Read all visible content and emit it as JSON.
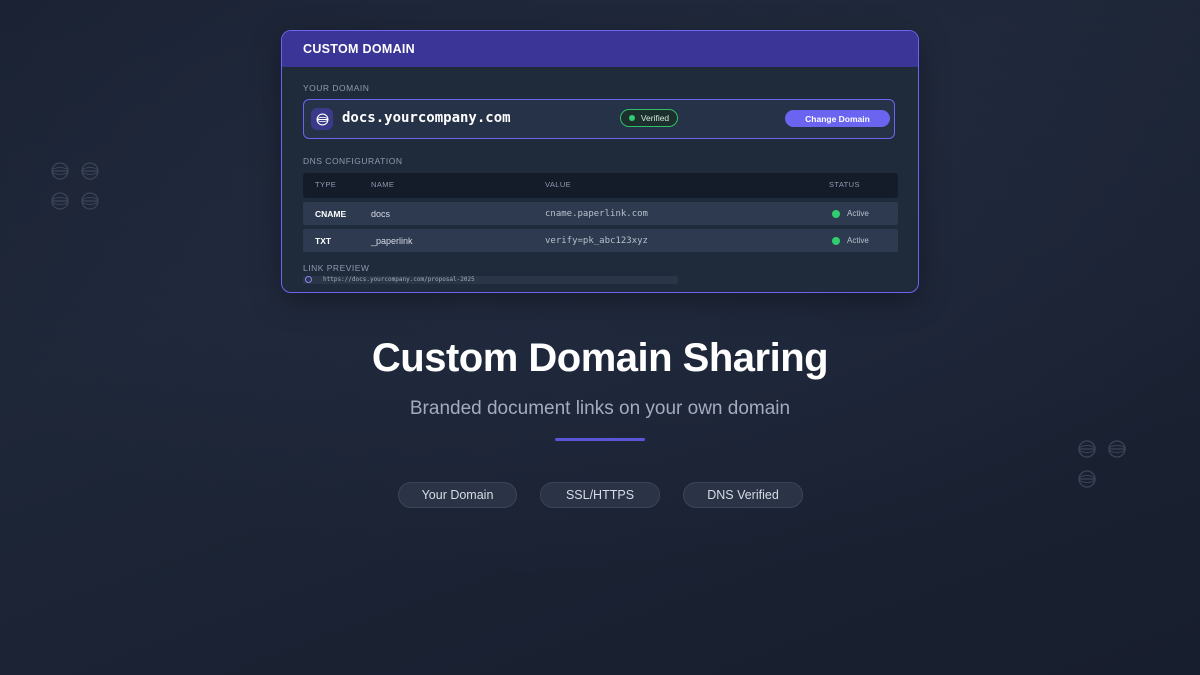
{
  "card": {
    "header_title": "CUSTOM DOMAIN",
    "your_domain_label": "YOUR DOMAIN",
    "domain": "docs.yourcompany.com",
    "verified_label": "Verified",
    "change_button_label": "Change Domain",
    "dns_label": "DNS CONFIGURATION",
    "dns_columns": [
      "TYPE",
      "NAME",
      "VALUE",
      "STATUS"
    ],
    "dns_rows": [
      {
        "type": "CNAME",
        "name": "docs",
        "value": "cname.paperlink.com",
        "status": "Active"
      },
      {
        "type": "TXT",
        "name": "_paperlink",
        "value": "verify=pk_abc123xyz",
        "status": "Active"
      }
    ],
    "link_preview_label": "LINK PREVIEW",
    "link_preview_url": "https://docs.yourcompany.com/proposal-2025"
  },
  "hero": {
    "title": "Custom Domain Sharing",
    "subtitle": "Branded document links on your own domain"
  },
  "features": [
    "Your Domain",
    "SSL/HTTPS",
    "DNS Verified"
  ],
  "icons": {
    "domain": "globe-icon",
    "verified": "status-dot-icon",
    "preview": "globe-icon",
    "decoration": "globe-icon"
  },
  "colors": {
    "accent": "#6b64f0",
    "header": "#3a3596",
    "success": "#2fcf6f",
    "background": "#1e2738"
  }
}
